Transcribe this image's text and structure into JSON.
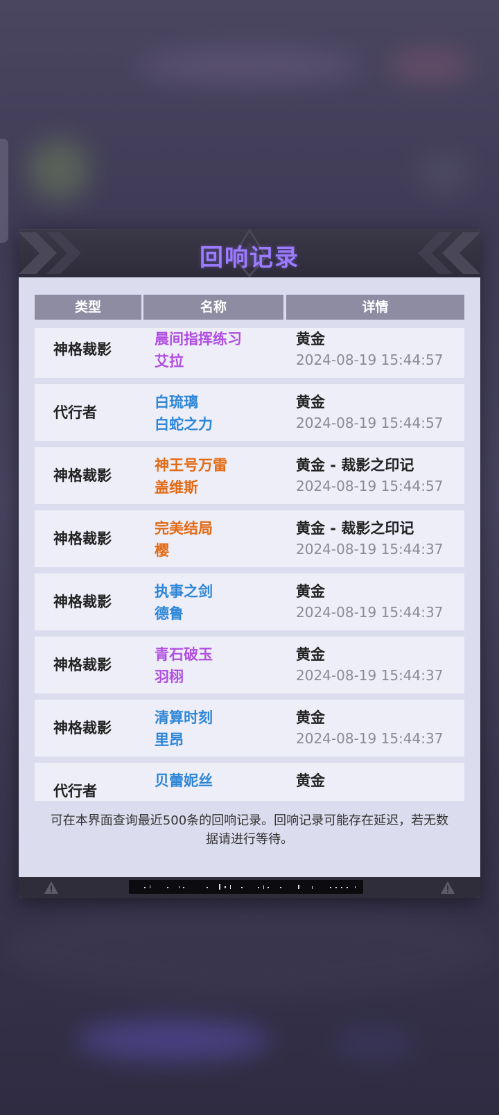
{
  "dialog": {
    "title": "回响记录",
    "columns": [
      "类型",
      "名称",
      "详情"
    ],
    "rows": [
      {
        "type": "神格裁影",
        "name1": "晨间指挥练习",
        "name2": "艾拉",
        "name_color": "purple",
        "detail": "黄金",
        "time": "2024-08-19 15:44:57"
      },
      {
        "type": "代行者",
        "name1": "白琉璃",
        "name2": "白蛇之力",
        "name_color": "blue",
        "detail": "黄金",
        "time": "2024-08-19 15:44:57"
      },
      {
        "type": "神格裁影",
        "name1": "神王号万雷",
        "name2": "盖维斯",
        "name_color": "orange",
        "detail": "黄金 - 裁影之印记",
        "time": "2024-08-19 15:44:57"
      },
      {
        "type": "神格裁影",
        "name1": "完美结局",
        "name2": "樱",
        "name_color": "orange",
        "detail": "黄金 - 裁影之印记",
        "time": "2024-08-19 15:44:37"
      },
      {
        "type": "神格裁影",
        "name1": "执事之剑",
        "name2": "德鲁",
        "name_color": "blue",
        "detail": "黄金",
        "time": "2024-08-19 15:44:37"
      },
      {
        "type": "神格裁影",
        "name1": "青石破玉",
        "name2": "羽栩",
        "name_color": "purple",
        "detail": "黄金",
        "time": "2024-08-19 15:44:37"
      },
      {
        "type": "神格裁影",
        "name1": "清算时刻",
        "name2": "里昂",
        "name_color": "blue",
        "detail": "黄金",
        "time": "2024-08-19 15:44:37"
      },
      {
        "type": "代行者",
        "name1": "贝蕾妮丝",
        "name2": "",
        "name_color": "blue",
        "detail": "黄金",
        "time": ""
      }
    ],
    "note": "可在本界面查询最近500条的回响记录。回响记录可能存在延迟，若无数据请进行等待。",
    "footer_icons": [
      "warning-icon",
      "barcode-strip",
      "warning-icon"
    ]
  },
  "colors": {
    "purple": "#b04fe0",
    "blue": "#2e86d6",
    "orange": "#e36a12",
    "title": "#9b7bff",
    "header_bg": "#8e8ca2"
  }
}
